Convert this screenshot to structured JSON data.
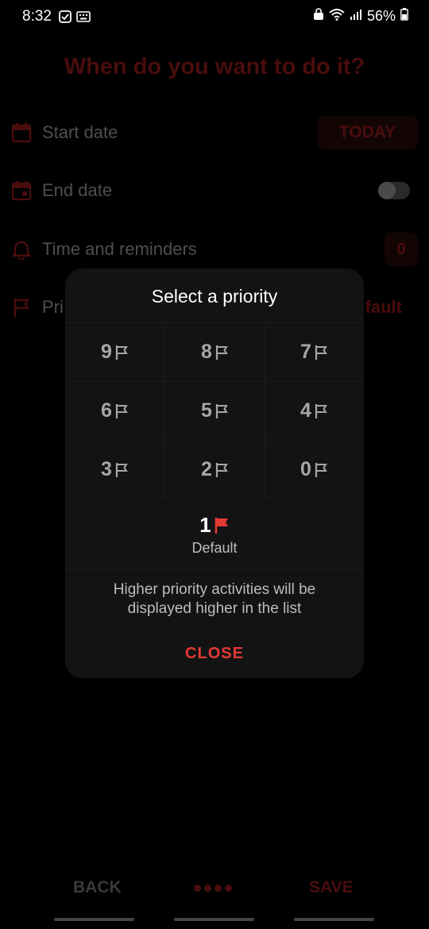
{
  "status_bar": {
    "time": "8:32",
    "battery": "56%"
  },
  "screen": {
    "title": "When do you want to do it?",
    "rows": [
      {
        "label": "Start date",
        "value": "TODAY"
      },
      {
        "label": "End date"
      },
      {
        "label": "Time and reminders",
        "value": "0"
      },
      {
        "label": "Pri",
        "value": "fault"
      }
    ]
  },
  "dialog": {
    "title": "Select a priority",
    "options": [
      "9",
      "8",
      "7",
      "6",
      "5",
      "4",
      "3",
      "2",
      "0"
    ],
    "default_value": "1",
    "default_label": "Default",
    "hint_line1": "Higher priority activities will be",
    "hint_line2": "displayed higher in the list",
    "close_label": "CLOSE"
  },
  "bottom_nav": {
    "back_label": "BACK",
    "save_label": "SAVE"
  },
  "colors": {
    "accent": "#e53935",
    "dim_accent": "#4a0d0d"
  }
}
